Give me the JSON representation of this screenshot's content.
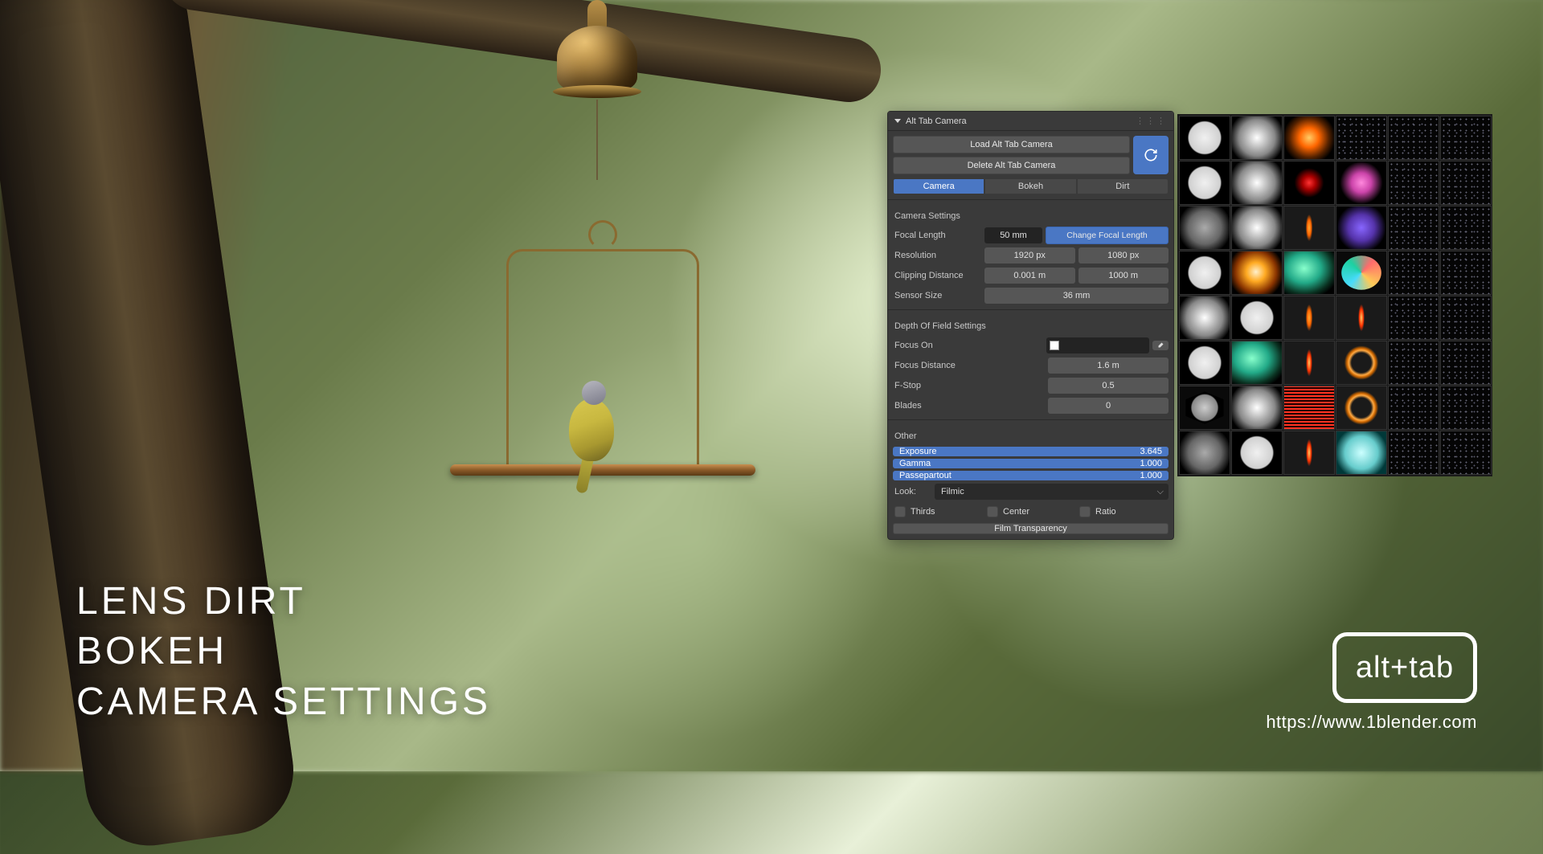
{
  "promo": {
    "line1": "LENS DIRT",
    "line2": "BOKEH",
    "line3": "CAMERA SETTINGS"
  },
  "logo_text": "alt+tab",
  "site_url": "https://www.1blender.com",
  "panel": {
    "title": "Alt Tab Camera",
    "load_btn": "Load Alt Tab Camera",
    "delete_btn": "Delete Alt Tab Camera",
    "tabs": {
      "camera": "Camera",
      "bokeh": "Bokeh",
      "dirt": "Dirt"
    },
    "sections": {
      "camera": "Camera Settings",
      "dof": "Depth Of Field Settings",
      "other": "Other"
    },
    "camera_settings": {
      "focal_length_label": "Focal Length",
      "focal_length_value": "50 mm",
      "change_focal_btn": "Change Focal Length",
      "resolution_label": "Resolution",
      "resolution_x": "1920 px",
      "resolution_y": "1080 px",
      "clipping_label": "Clipping Distance",
      "clipping_near": "0.001 m",
      "clipping_far": "1000 m",
      "sensor_label": "Sensor Size",
      "sensor_value": "36 mm"
    },
    "dof": {
      "focus_on_label": "Focus On",
      "focus_on_value": "",
      "focus_distance_label": "Focus Distance",
      "focus_distance_value": "1.6 m",
      "fstop_label": "F-Stop",
      "fstop_value": "0.5",
      "blades_label": "Blades",
      "blades_value": "0"
    },
    "other": {
      "exposure_label": "Exposure",
      "exposure_value": "3.645",
      "gamma_label": "Gamma",
      "gamma_value": "1.000",
      "passepartout_label": "Passepartout",
      "passepartout_value": "1.000",
      "look_label": "Look:",
      "look_value": "Filmic",
      "thirds": "Thirds",
      "center": "Center",
      "ratio": "Ratio",
      "film_transparency": "Film Transparency"
    }
  }
}
